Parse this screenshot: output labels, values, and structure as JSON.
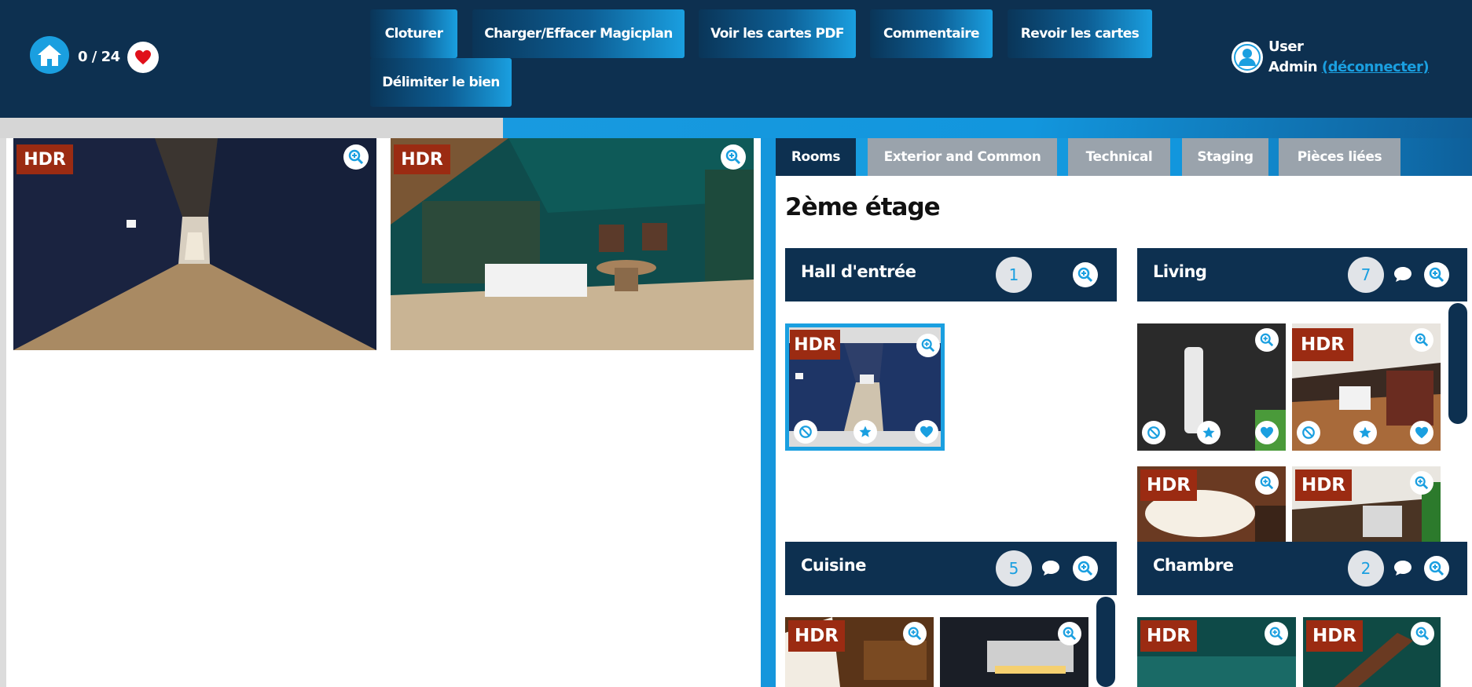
{
  "header": {
    "counter": "0 / 24",
    "buttons": {
      "cloturer": "Cloturer",
      "magicplan": "Charger/Effacer Magicplan",
      "cartes_pdf": "Voir les cartes PDF",
      "commentaire": "Commentaire",
      "revoir": "Revoir les cartes",
      "delimiter": "Délimiter le bien"
    },
    "user": {
      "line1": "User",
      "line2": "Admin",
      "logout": "(déconnecter)"
    }
  },
  "badge_text": "HDR",
  "tabs": [
    "Rooms",
    "Exterior and Common",
    "Technical",
    "Staging",
    "Pièces liées"
  ],
  "floor_title": "2ème étage",
  "rooms": {
    "hall": {
      "name": "Hall d'entrée",
      "count": "1"
    },
    "living": {
      "name": "Living",
      "count": "7"
    },
    "cuisine": {
      "name": "Cuisine",
      "count": "5"
    },
    "chambre": {
      "name": "Chambre",
      "count": "2"
    }
  },
  "colors": {
    "header_bg": "#0d3050",
    "accent_blue": "#1a9fe0",
    "hdr_badge": "#9b2b12",
    "tab_inactive": "#9aa3ac",
    "favorite_red": "#e0101a"
  },
  "icons": [
    "home-icon",
    "heart-icon",
    "user-icon",
    "zoom-in-icon",
    "comment-icon",
    "ban-icon",
    "star-icon"
  ]
}
